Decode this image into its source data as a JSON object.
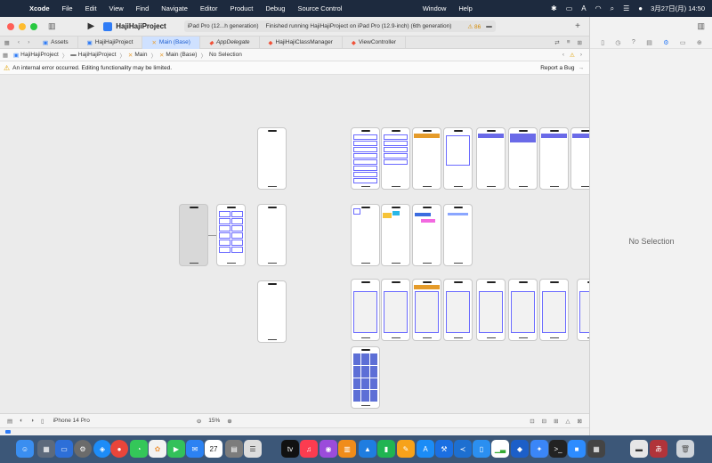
{
  "menubar": {
    "app_name": "Xcode",
    "items": [
      "File",
      "Edit",
      "View",
      "Find",
      "Navigate",
      "Editor",
      "Product",
      "Debug",
      "Source Control",
      "Window",
      "Help"
    ],
    "clock": "3月27日(月) 14:50"
  },
  "toolbar": {
    "project_name": "HajiHajiProject",
    "device": "iPad Pro (12...h generation)",
    "status_text": "Finished running HajiHajiProject on iPad Pro (12.9-inch) (6th generation)",
    "warning_count": "86"
  },
  "tabs": [
    {
      "label": "Assets",
      "icon": "assets-icon"
    },
    {
      "label": "HajiHajiProject",
      "icon": "project-icon"
    },
    {
      "label": "Main (Base)",
      "icon": "storyboard-icon",
      "active": true
    },
    {
      "label": "AppDelegate",
      "icon": "swift-icon",
      "italic": true
    },
    {
      "label": "HajiHajiClassManager",
      "icon": "swift-icon"
    },
    {
      "label": "ViewController",
      "icon": "swift-icon"
    }
  ],
  "jumpbar": {
    "crumbs": [
      "HajiHajiProject",
      "HajiHajiProject",
      "Main",
      "Main (Base)",
      "No Selection"
    ]
  },
  "errorbar": {
    "message": "An internal error occurred. Editing functionality may be limited.",
    "report": "Report a Bug"
  },
  "bottombar": {
    "device": "iPhone 14 Pro",
    "zoom": "15%"
  },
  "inspector": {
    "no_selection": "No Selection"
  },
  "colors": {
    "accent": "#2f7cf6",
    "constraint": "#6a6aff"
  }
}
